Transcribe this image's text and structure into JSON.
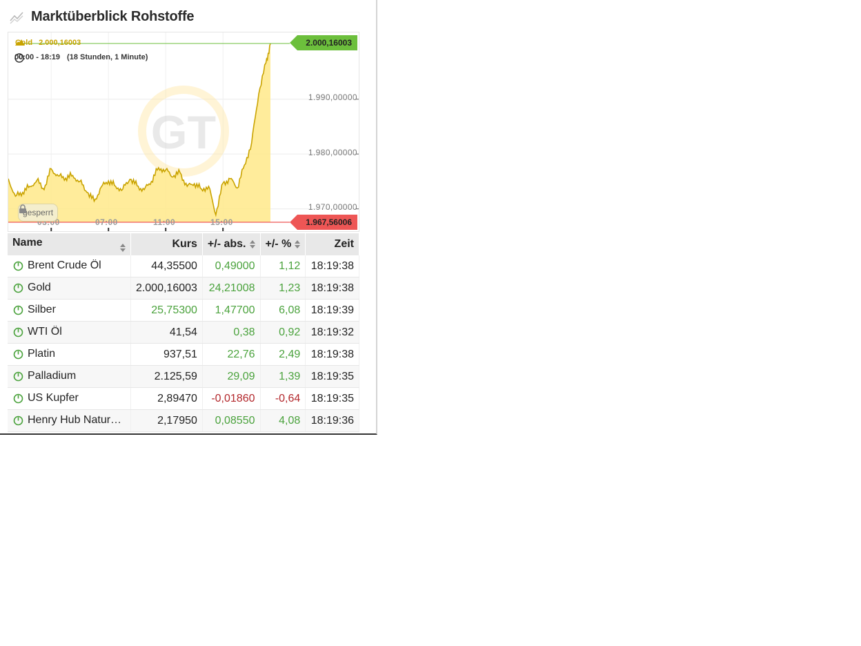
{
  "widget": {
    "title": "Marktüberblick Rohstoffe",
    "title_icon": "chart-line-icon"
  },
  "chart": {
    "series_name": "Gold",
    "series_value": "2.000,16003",
    "time_range": "00:00 - 18:19",
    "duration": "(18 Stunden, 1 Minute)",
    "y_ticks": [
      "1.990,00000",
      "1.980,00000",
      "1.970,00000"
    ],
    "x_ticks": [
      "03:00",
      "07:00",
      "11:00",
      "15:00"
    ],
    "high_flag": "2.000,16003",
    "low_flag": "1.967,56006",
    "lock_label": "gesperrt",
    "colors": {
      "line": "#c9a300",
      "fill": "#ffe98a",
      "high": "#6cbf3c",
      "low": "#ee5655"
    }
  },
  "chart_data": {
    "type": "area",
    "series": [
      {
        "name": "Gold",
        "x": [
          "00:00",
          "00:30",
          "01:00",
          "01:30",
          "02:00",
          "02:30",
          "03:00",
          "03:30",
          "04:00",
          "04:30",
          "05:00",
          "05:30",
          "06:00",
          "06:30",
          "07:00",
          "07:30",
          "08:00",
          "08:30",
          "09:00",
          "09:30",
          "10:00",
          "10:30",
          "11:00",
          "11:30",
          "12:00",
          "12:30",
          "13:00",
          "13:30",
          "14:00",
          "14:30",
          "15:00",
          "15:30",
          "16:00",
          "16:30",
          "17:00",
          "17:30",
          "18:00",
          "18:19"
        ],
        "y": [
          1975.5,
          1972.3,
          1973.0,
          1974.1,
          1975.2,
          1973.5,
          1977.3,
          1976.0,
          1975.6,
          1976.1,
          1975.0,
          1973.0,
          1971.4,
          1974.0,
          1975.1,
          1974.1,
          1973.6,
          1975.4,
          1974.2,
          1973.5,
          1975.0,
          1977.5,
          1977.1,
          1975.8,
          1976.6,
          1974.1,
          1974.6,
          1973.6,
          1974.1,
          1968.9,
          1974.7,
          1975.5,
          1973.8,
          1978.0,
          1982.0,
          1991.0,
          1996.6,
          2000.16
        ]
      }
    ],
    "ylim": [
      1967.56,
      2000.16
    ],
    "y_ticks": [
      1990,
      1980,
      1970
    ],
    "x_ticks": [
      "03:00",
      "07:00",
      "11:00",
      "15:00"
    ]
  },
  "table": {
    "headers": {
      "name": "Name",
      "kurs": "Kurs",
      "abs": "+/- abs.",
      "pct": "+/- %",
      "zeit": "Zeit"
    },
    "rows": [
      {
        "name": "Brent Crude Öl",
        "kurs": "44,35500",
        "abs": "0,49000",
        "pct": "1,12",
        "zeit": "18:19:38",
        "kurs_tone": "neu",
        "tone": "pos"
      },
      {
        "name": "Gold",
        "kurs": "2.000,16003",
        "abs": "24,21008",
        "pct": "1,23",
        "zeit": "18:19:38",
        "kurs_tone": "neu",
        "tone": "pos"
      },
      {
        "name": "Silber",
        "kurs": "25,75300",
        "abs": "1,47700",
        "pct": "6,08",
        "zeit": "18:19:39",
        "kurs_tone": "pos",
        "tone": "pos"
      },
      {
        "name": "WTI Öl",
        "kurs": "41,54",
        "abs": "0,38",
        "pct": "0,92",
        "zeit": "18:19:32",
        "kurs_tone": "neu",
        "tone": "pos"
      },
      {
        "name": "Platin",
        "kurs": "937,51",
        "abs": "22,76",
        "pct": "2,49",
        "zeit": "18:19:38",
        "kurs_tone": "neu",
        "tone": "pos"
      },
      {
        "name": "Palladium",
        "kurs": "2.125,59",
        "abs": "29,09",
        "pct": "1,39",
        "zeit": "18:19:35",
        "kurs_tone": "neu",
        "tone": "pos"
      },
      {
        "name": "US Kupfer",
        "kurs": "2,89470",
        "abs": "-0,01860",
        "pct": "-0,64",
        "zeit": "18:19:35",
        "kurs_tone": "neu",
        "tone": "neg"
      },
      {
        "name": "Henry Hub Naturgas",
        "kurs": "2,17950",
        "abs": "0,08550",
        "pct": "4,08",
        "zeit": "18:19:36",
        "kurs_tone": "neu",
        "tone": "pos"
      }
    ]
  }
}
